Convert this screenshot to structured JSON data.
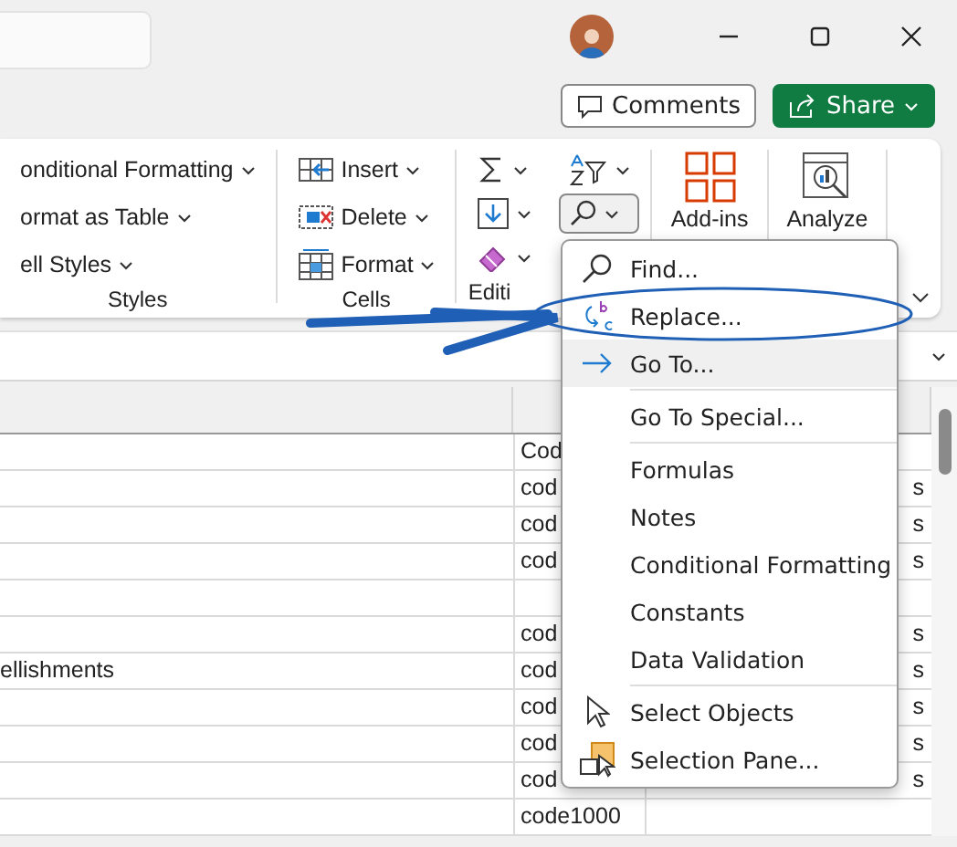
{
  "header_buttons": [
    {
      "kind": "comments",
      "label": "Comments"
    },
    {
      "kind": "share",
      "label": "Share"
    }
  ],
  "ribbon": {
    "groups": [
      {
        "label": "Styles",
        "items": [
          {
            "kind": "conditional",
            "label": "onditional Formatting"
          },
          {
            "kind": "table",
            "label": "ormat as Table"
          },
          {
            "kind": "styles",
            "label": "ell Styles"
          }
        ]
      },
      {
        "label": "Cells",
        "items": [
          {
            "kind": "insert",
            "label": "Insert"
          },
          {
            "kind": "delete",
            "label": "Delete"
          },
          {
            "kind": "format",
            "label": "Format"
          }
        ]
      },
      {
        "label": "Editi",
        "items": [
          {
            "kind": "sum",
            "pressed": false
          },
          {
            "kind": "fill",
            "pressed": false
          },
          {
            "kind": "clear",
            "pressed": false
          },
          {
            "kind": "sort",
            "pressed": false
          },
          {
            "kind": "find",
            "pressed": true
          }
        ]
      },
      {
        "label": "Add-ins",
        "items": [
          {
            "kind": "addins"
          }
        ]
      },
      {
        "label": "Analyze",
        "items": [
          {
            "kind": "analyze"
          }
        ]
      }
    ]
  },
  "sheet": {
    "rows": [
      {
        "column_1": "",
        "column_2": "Cod",
        "column_3": ""
      },
      {
        "column_1": "",
        "column_2": "cod",
        "column_3": "s"
      },
      {
        "column_1": "",
        "column_2": "cod",
        "column_3": "s"
      },
      {
        "column_1": "",
        "column_2": "cod",
        "column_3": "s"
      },
      {
        "column_1": "",
        "column_2": "",
        "column_3": ""
      },
      {
        "column_1": "",
        "column_2": "cod",
        "column_3": "s"
      },
      {
        "column_1": "ellishments",
        "column_2": "cod",
        "column_3": "s"
      },
      {
        "column_1": "",
        "column_2": "cod",
        "column_3": "s"
      },
      {
        "column_1": "",
        "column_2": "cod",
        "column_3": "s"
      },
      {
        "column_1": "",
        "column_2": "cod",
        "column_3": "s"
      },
      {
        "column_1": "",
        "column_2": "code1000",
        "column_3": ""
      }
    ]
  },
  "find_menu": {
    "items": [
      {
        "kind": "find",
        "label": "Find...",
        "highlighted": false
      },
      {
        "kind": "replace",
        "label": "Replace...",
        "highlighted": false
      },
      {
        "kind": "goto",
        "label": "Go To...",
        "highlighted": true
      },
      {
        "kind": "divider"
      },
      {
        "kind": "plain",
        "label": "Go To Special...",
        "highlighted": false
      },
      {
        "kind": "divider"
      },
      {
        "kind": "plain",
        "label": "Formulas",
        "highlighted": false
      },
      {
        "kind": "plain",
        "label": "Notes",
        "highlighted": false
      },
      {
        "kind": "plain",
        "label": "Conditional Formatting",
        "highlighted": false
      },
      {
        "kind": "plain",
        "label": "Constants",
        "highlighted": false
      },
      {
        "kind": "plain",
        "label": "Data Validation",
        "highlighted": false
      },
      {
        "kind": "divider"
      },
      {
        "kind": "select",
        "label": "Select Objects",
        "highlighted": false
      },
      {
        "kind": "pane",
        "label": "Selection Pane...",
        "highlighted": false
      }
    ]
  }
}
